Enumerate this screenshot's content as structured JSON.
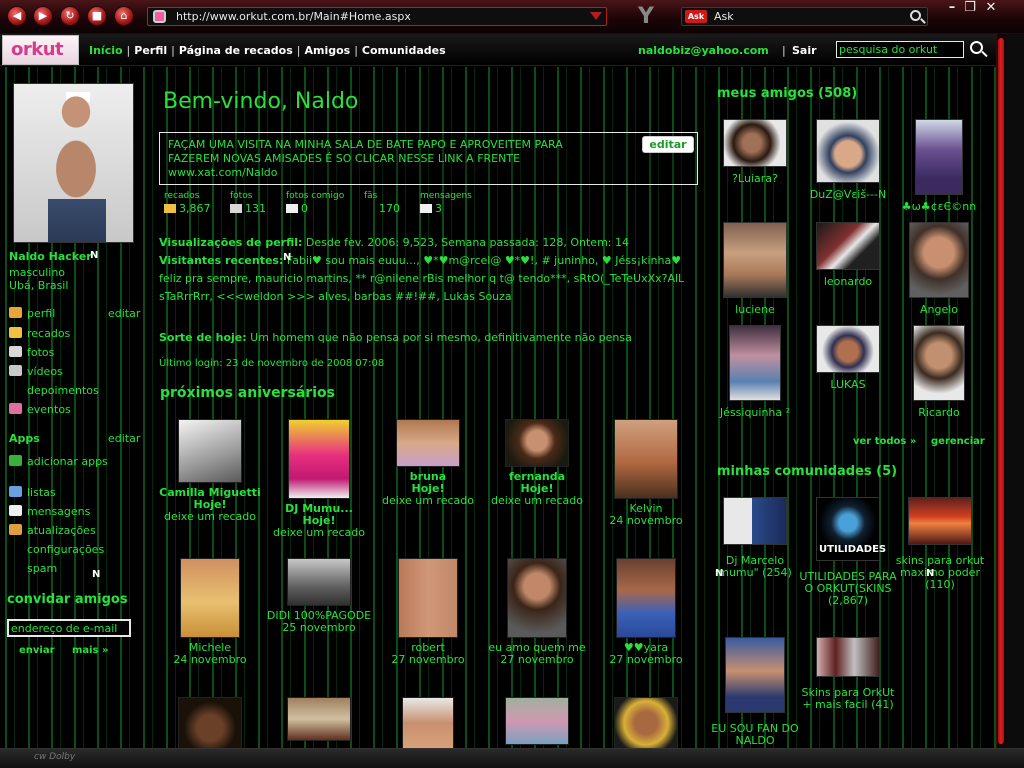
{
  "browser": {
    "url": "http://www.orkut.com.br/Main#Home.aspx",
    "search_engine": "Ask",
    "status_text": "cw Dolby"
  },
  "topbar": {
    "logo": "orkut",
    "nav": [
      "Início",
      "Perfil",
      "Página de recados",
      "Amigos",
      "Comunidades"
    ],
    "email": "naldobiz@yahoo.com",
    "logout": "Sair",
    "search_placeholder": "pesquisa do orkut"
  },
  "profile": {
    "name": "Naldo Hacker",
    "gender": "masculino",
    "city": "Ubá, Brasil",
    "edit_label": "editar",
    "menu": [
      "perfil",
      "recados",
      "fotos",
      "vídeos",
      "depoimentos",
      "eventos"
    ],
    "apps_title": "Apps",
    "apps_edit": "editar",
    "add_apps": "adicionar apps",
    "menu2": [
      "listas",
      "mensagens",
      "atualizações",
      "configurações",
      "spam"
    ],
    "invite_title": "convidar amigos",
    "invite_placeholder": "endereço de e-mail",
    "invite_send": "enviar",
    "invite_more": "mais »"
  },
  "main": {
    "welcome": "Bem-vindo, Naldo",
    "scrap_text": "FAÇAM UMA VISITA NA MINHA SALA DE BATE PAPO E APROVEITEM PARA FAZEREM NOVAS AMISADES É SO CLICAR NESSE LINK A FRENTE www.xat.com/Naldo",
    "scrap_edit": "editar",
    "stats": [
      {
        "label": "recados",
        "value": "3,867"
      },
      {
        "label": "fotos",
        "value": "131"
      },
      {
        "label": "fotos comigo",
        "value": "0"
      },
      {
        "label": "fãs",
        "value": "170"
      },
      {
        "label": "mensagens",
        "value": "3"
      }
    ],
    "views_label": "Visualizações de perfil:",
    "views_text": "Desde fev. 2006: 9,523, Semana passada: 128, Ontem: 14",
    "visitors_label": "Visitantes recentes:",
    "visitors_text": "Fabii♥ sou mais euuu..., ♥*♥m@rcel@ ♥*♥!, # juninho, ♥ Jéss¡kinha♥ feliz pra sempre, mauricio martins, ** r@nilene rBis melhor q t@ tendo***, sRtO(_TeTeUxXx?AlL sTaRrrRrr, <<<weldon >>> alves, barbas ##!##, Lukas Souza",
    "luck_label": "Sorte de hoje:",
    "luck_text": "Um homem que não pensa por si mesmo, definitivamente não pensa",
    "last_login": "Último login: 23 de novembro de 2008 07:08",
    "birthdays_title": "próximos aniversários",
    "birthdays_row1": [
      {
        "name": "Camilla Miguetti",
        "when": "Hoje!",
        "action": "deixe um recado"
      },
      {
        "name": "DJ Mumu...",
        "when": "Hoje!",
        "action": "deixe um recado"
      },
      {
        "name": "bruna",
        "when": "Hoje!",
        "action": "deixe um recado"
      },
      {
        "name": "fernanda",
        "when": "Hoje!",
        "action": "deixe um recado"
      },
      {
        "name": "Kelvin",
        "when": "24 novembro",
        "action": ""
      }
    ],
    "birthdays_row2": [
      {
        "name": "Michele",
        "when": "24 novembro"
      },
      {
        "name": "DIDI 100%PAGODE",
        "when": "25 novembro"
      },
      {
        "name": "robert",
        "when": "27 novembro"
      },
      {
        "name": "eu amo quem me",
        "when": "27 novembro"
      },
      {
        "name": "♥♥yara",
        "when": "27 novembro"
      }
    ]
  },
  "friends": {
    "title": "meus amigos (508)",
    "list": [
      "?Luiara?",
      "DuZ@Vεiš---N",
      "♣ω♣¢εЄ©nn",
      "luciene",
      "leonardo",
      "Angelo",
      "Jéssiquinha ²",
      "LUKAS",
      "Ricardo"
    ],
    "see_all": "ver todos »",
    "manage": "gerenciar"
  },
  "communities": {
    "title": "minhas comunidades (5)",
    "list": [
      {
        "name": "Dj Marcelo mumu\" (254)"
      },
      {
        "name": "UTILIDADES PARA O ORKUT(SKINS (2,867)"
      },
      {
        "name": "skins para orkut maximo poder (110)"
      },
      {
        "name": "EU SOU FAN DO NALDO PROSTITUTO"
      },
      {
        "name": "Skins para OrkUt + mais facil (41)"
      }
    ],
    "utilidades_badge": "UTILIDADES"
  },
  "colors": {
    "accent_green": "#2ae03c",
    "browser_red": "#b01e1e",
    "orkut_pink": "#d73c8c"
  }
}
